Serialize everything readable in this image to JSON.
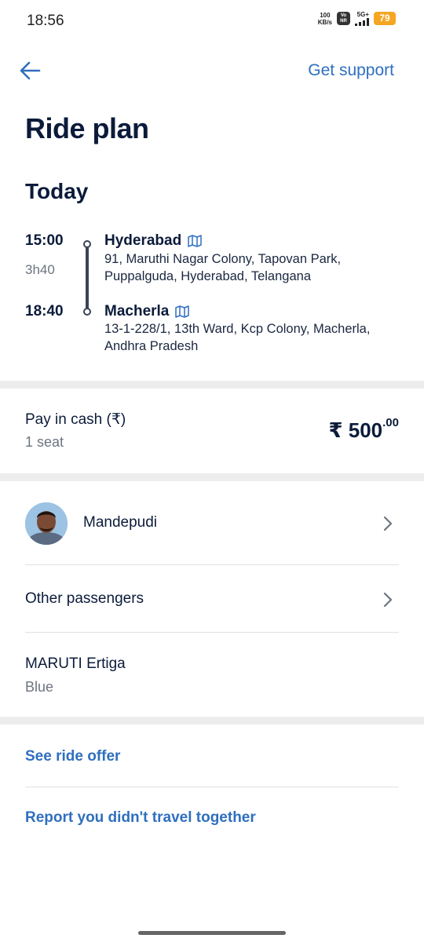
{
  "status_bar": {
    "time": "18:56",
    "net_speed_value": "100",
    "net_speed_unit": "KB/s",
    "volte_top": "Vo",
    "volte_bottom": "NR",
    "signal_label": "5G+",
    "battery": "79"
  },
  "header": {
    "support_label": "Get support"
  },
  "page": {
    "title": "Ride plan",
    "day": "Today"
  },
  "route": {
    "duration": "3h40",
    "departure": {
      "time": "15:00",
      "city": "Hyderabad",
      "address": "91, Maruthi Nagar Colony, Tapovan Park, Puppalguda, Hyderabad, Telangana"
    },
    "arrival": {
      "time": "18:40",
      "city": "Macherla",
      "address": "13-1-228/1, 13th Ward, Kcp Colony, Macherla, Andhra Pradesh"
    }
  },
  "payment": {
    "title": "Pay in cash (₹)",
    "seats": "1 seat",
    "price_main": "₹ 500",
    "price_decimals": ".00"
  },
  "driver": {
    "name": "Mandepudi"
  },
  "passengers": {
    "label": "Other passengers"
  },
  "car": {
    "model": "MARUTI Ertiga",
    "color": "Blue"
  },
  "links": {
    "see_offer": "See ride offer",
    "report": "Report you didn't travel together"
  },
  "colors": {
    "accent": "#2f6fbf",
    "text_primary": "#0b1b3a",
    "text_secondary": "#6d7480",
    "battery": "#f5a623"
  }
}
